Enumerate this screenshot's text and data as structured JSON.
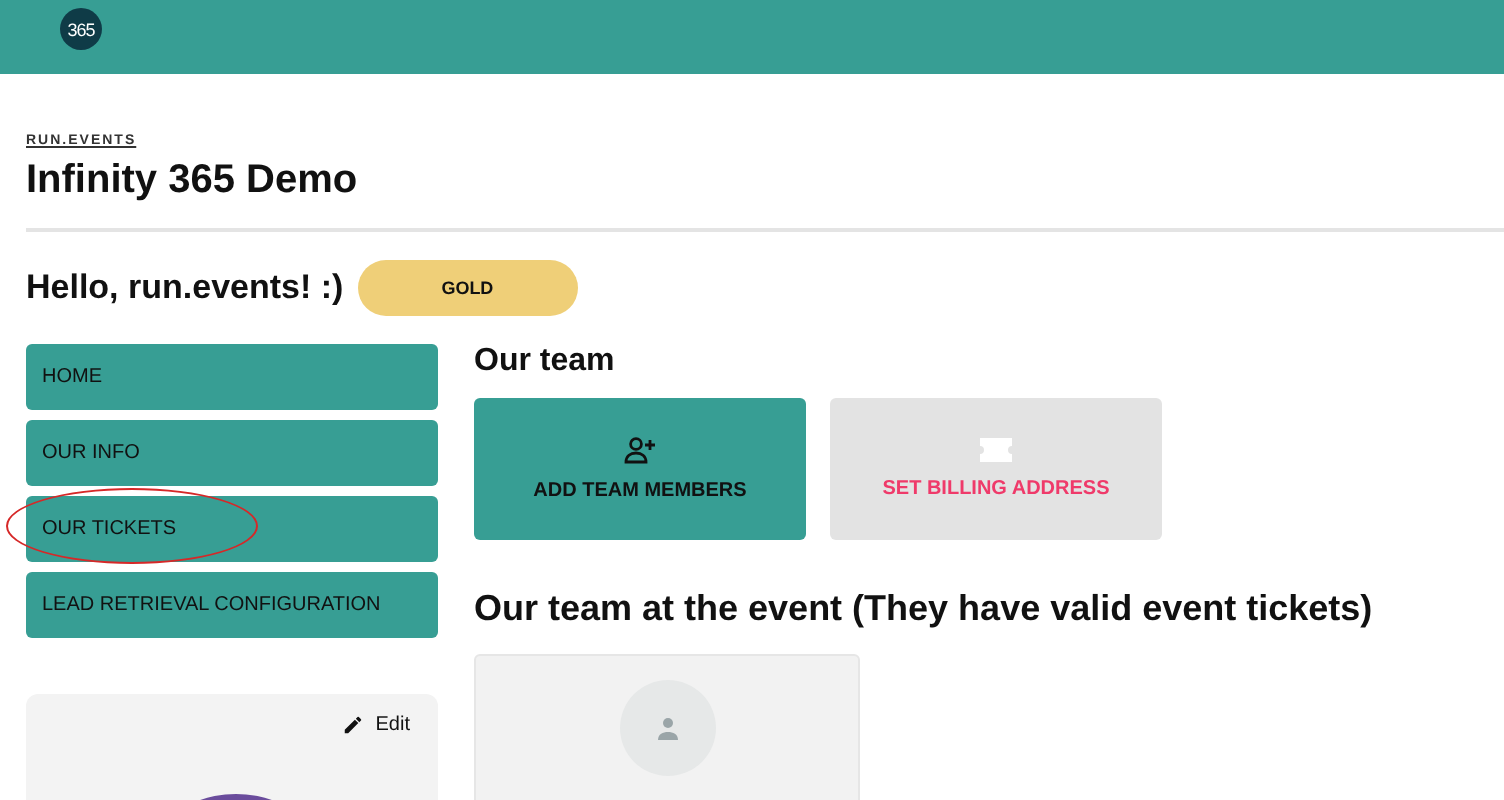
{
  "header": {
    "logo": "365"
  },
  "org": {
    "link": "RUN.EVENTS",
    "title": "Infinity 365 Demo"
  },
  "greeting": {
    "text": "Hello, run.events! :)",
    "tier": "GOLD"
  },
  "nav": [
    {
      "label": "HOME",
      "circled": false
    },
    {
      "label": "OUR INFO",
      "circled": false
    },
    {
      "label": "OUR TICKETS",
      "circled": true
    },
    {
      "label": "LEAD RETRIEVAL CONFIGURATION",
      "circled": false
    }
  ],
  "profile_card": {
    "edit": "Edit"
  },
  "team": {
    "heading": "Our team",
    "actions": [
      {
        "label": "ADD TEAM MEMBERS",
        "kind": "add",
        "disabled": false
      },
      {
        "label": "SET BILLING ADDRESS",
        "kind": "billing",
        "disabled": true
      }
    ]
  },
  "event_team": {
    "heading": "Our team at the event (They have valid event tickets)",
    "members": [
      {
        "kind": "placeholder"
      }
    ]
  }
}
